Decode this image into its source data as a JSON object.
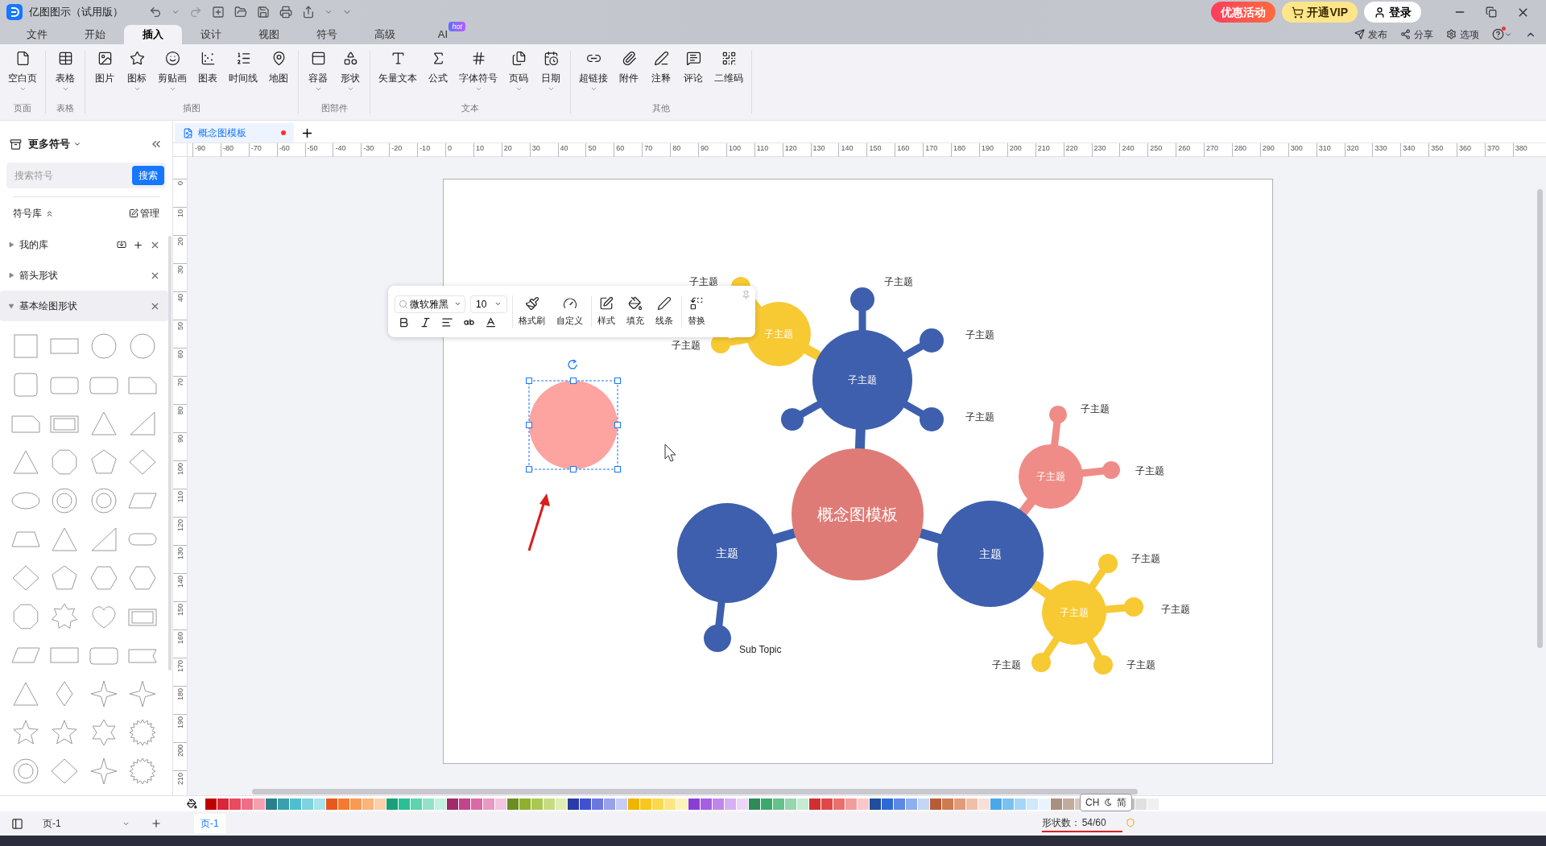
{
  "app": {
    "title": "亿图图示（试用版）"
  },
  "header_buttons": [
    {
      "label": "优惠活动",
      "kind": "promo"
    },
    {
      "label": "开通VIP",
      "kind": "vip"
    },
    {
      "label": "登录",
      "kind": "login"
    }
  ],
  "menu_tabs": [
    {
      "label": "文件",
      "selected": false
    },
    {
      "label": "开始",
      "selected": false
    },
    {
      "label": "插入",
      "selected": true
    },
    {
      "label": "设计",
      "selected": false
    },
    {
      "label": "视图",
      "selected": false
    },
    {
      "label": "符号",
      "selected": false
    },
    {
      "label": "高级",
      "selected": false
    },
    {
      "label": "AI",
      "selected": false,
      "badge": "hot"
    }
  ],
  "header_actions": [
    "发布",
    "分享",
    "选项"
  ],
  "ribbon": {
    "groups": [
      {
        "label": "页面",
        "items": [
          {
            "label": "空白页",
            "dropdown": true
          }
        ]
      },
      {
        "label": "表格",
        "items": [
          {
            "label": "表格",
            "dropdown": true
          }
        ]
      },
      {
        "label": "插图",
        "items": [
          {
            "label": "图片",
            "dropdown": false
          },
          {
            "label": "图标",
            "dropdown": true
          },
          {
            "label": "剪贴画",
            "dropdown": true
          },
          {
            "label": "图表",
            "dropdown": false
          },
          {
            "label": "时间线",
            "dropdown": false
          },
          {
            "label": "地图",
            "dropdown": false
          }
        ]
      },
      {
        "label": "图部件",
        "items": [
          {
            "label": "容器",
            "dropdown": true
          },
          {
            "label": "形状",
            "dropdown": true
          }
        ]
      },
      {
        "label": "文本",
        "items": [
          {
            "label": "矢量文本",
            "dropdown": false
          },
          {
            "label": "公式",
            "dropdown": false
          },
          {
            "label": "字体符号",
            "dropdown": true
          },
          {
            "label": "页码",
            "dropdown": true
          },
          {
            "label": "日期",
            "dropdown": true
          }
        ]
      },
      {
        "label": "其他",
        "items": [
          {
            "label": "超链接",
            "dropdown": true
          },
          {
            "label": "附件",
            "dropdown": false
          },
          {
            "label": "注释",
            "dropdown": false
          },
          {
            "label": "评论",
            "dropdown": false
          },
          {
            "label": "二维码",
            "dropdown": false
          }
        ]
      }
    ]
  },
  "sidebar": {
    "title": "更多符号",
    "search": {
      "placeholder": "搜索符号",
      "button": "搜索"
    },
    "library_label": "符号库",
    "manage": "管理",
    "libraries": [
      {
        "name": "我的库",
        "expanded": false,
        "kind": "custom"
      },
      {
        "name": "箭头形状",
        "expanded": false,
        "kind": "builtin"
      },
      {
        "name": "基本绘图形状",
        "expanded": true,
        "kind": "builtin"
      }
    ]
  },
  "document_tabs": [
    {
      "title": "概念图模板",
      "selected": true,
      "modified": true
    }
  ],
  "ruler": {
    "horizontal": [
      "-90",
      "-80",
      "-70",
      "-60",
      "-50",
      "-40",
      "-30",
      "-20",
      "-10",
      "0",
      "10",
      "20",
      "30",
      "40",
      "50",
      "60",
      "70",
      "80",
      "90",
      "100",
      "110",
      "120",
      "130",
      "140",
      "150",
      "160",
      "170",
      "180",
      "190",
      "200",
      "210",
      "220",
      "230",
      "240",
      "250",
      "260",
      "270",
      "280",
      "290",
      "300",
      "310",
      "320",
      "330",
      "340",
      "350",
      "360",
      "370",
      "380"
    ],
    "vertical": [
      "0",
      "10",
      "20",
      "30",
      "40",
      "50",
      "60",
      "70",
      "80",
      "90",
      "100",
      "110",
      "120",
      "130",
      "140",
      "150",
      "160",
      "170",
      "180",
      "190",
      "200",
      "210"
    ]
  },
  "format_toolbar": {
    "font": "微软雅黑",
    "size": "10",
    "actions": [
      "格式刷",
      "自定义",
      "样式",
      "填充",
      "线条",
      "替换"
    ]
  },
  "mind_map": {
    "nodes": [
      {
        "kind": "subtopic",
        "text": "子主题",
        "color": "#f7c932",
        "children": [
          {
            "text": "子主题"
          },
          {
            "text": "子主题"
          }
        ]
      },
      {
        "kind": "subtopic",
        "text": "子主题",
        "color": "#3d5fad",
        "children": [
          {
            "text": "子主题"
          },
          {
            "text": "子主题"
          },
          {
            "text": "子主题"
          }
        ]
      },
      {
        "kind": "center",
        "text": "概念图模板",
        "color": "#df7b76"
      },
      {
        "kind": "topic",
        "text": "主题",
        "color": "#3d5fad",
        "children": [
          {
            "text": "Sub Topic"
          }
        ]
      },
      {
        "kind": "topic",
        "text": "主题",
        "color": "#3d5fad"
      },
      {
        "kind": "subtopic",
        "text": "子主题",
        "color": "#ef8c87",
        "children": [
          {
            "text": "子主题"
          },
          {
            "text": "子主题"
          }
        ]
      },
      {
        "kind": "subtopic",
        "text": "子主题",
        "color": "#f7c932",
        "children": [
          {
            "text": "子主题"
          },
          {
            "text": "子主题"
          },
          {
            "text": "子主题"
          },
          {
            "text": "子主题"
          }
        ]
      }
    ],
    "selected_shape": {
      "kind": "circle",
      "color": "#fda3a0",
      "selected": true
    }
  },
  "ime": {
    "mode": "CH",
    "script": "简"
  },
  "status_bar": {
    "page_select": "页-1",
    "page_tabs": [
      {
        "label": "页-1",
        "selected": true
      }
    ],
    "shape_count_label": "形状数：",
    "shape_count": "54/60"
  }
}
